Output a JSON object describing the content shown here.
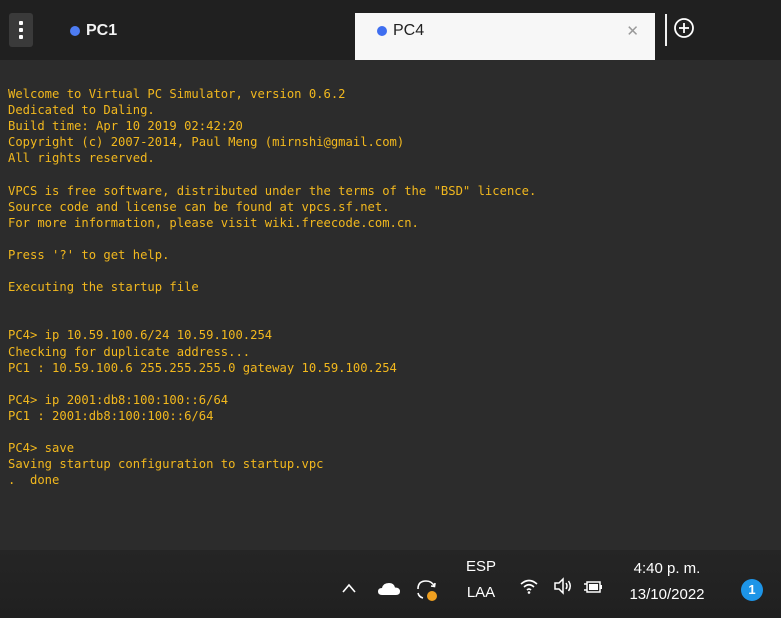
{
  "tabs": [
    {
      "label": "PC1",
      "dot_color": "#4d7cf2",
      "active": false
    },
    {
      "label": "PC4",
      "dot_color": "#3f6ef0",
      "active": true,
      "close_icon": "close-icon"
    }
  ],
  "toolbar": {
    "menu_icon": "kebab-menu-icon",
    "add_icon": "add-tab-icon"
  },
  "terminal": {
    "text_color": "#f2b81e",
    "background": "#2c2c2c",
    "lines": [
      "Welcome to Virtual PC Simulator, version 0.6.2",
      "Dedicated to Daling.",
      "Build time: Apr 10 2019 02:42:20",
      "Copyright (c) 2007-2014, Paul Meng (mirnshi@gmail.com)",
      "All rights reserved.",
      "",
      "VPCS is free software, distributed under the terms of the \"BSD\" licence.",
      "Source code and license can be found at vpcs.sf.net.",
      "For more information, please visit wiki.freecode.com.cn.",
      "",
      "Press '?' to get help.",
      "",
      "Executing the startup file",
      "",
      "",
      "PC4> ip 10.59.100.6/24 10.59.100.254",
      "Checking for duplicate address...",
      "PC1 : 10.59.100.6 255.255.255.0 gateway 10.59.100.254",
      "",
      "PC4> ip 2001:db8:100:100::6/64",
      "PC1 : 2001:db8:100:100::6/64",
      "",
      "PC4> save",
      "Saving startup configuration to startup.vpc",
      ".  done"
    ]
  },
  "taskbar": {
    "tray_icons": [
      "chevron-up-icon",
      "cloud-icon",
      "storage-sync-icon",
      "wifi-icon",
      "volume-icon",
      "battery-icon"
    ],
    "language_line1": "ESP",
    "language_line2": "LAA",
    "time": "4:40 p. m.",
    "date": "13/10/2022",
    "notification_count": "1",
    "notification_color": "#1d95e8"
  }
}
